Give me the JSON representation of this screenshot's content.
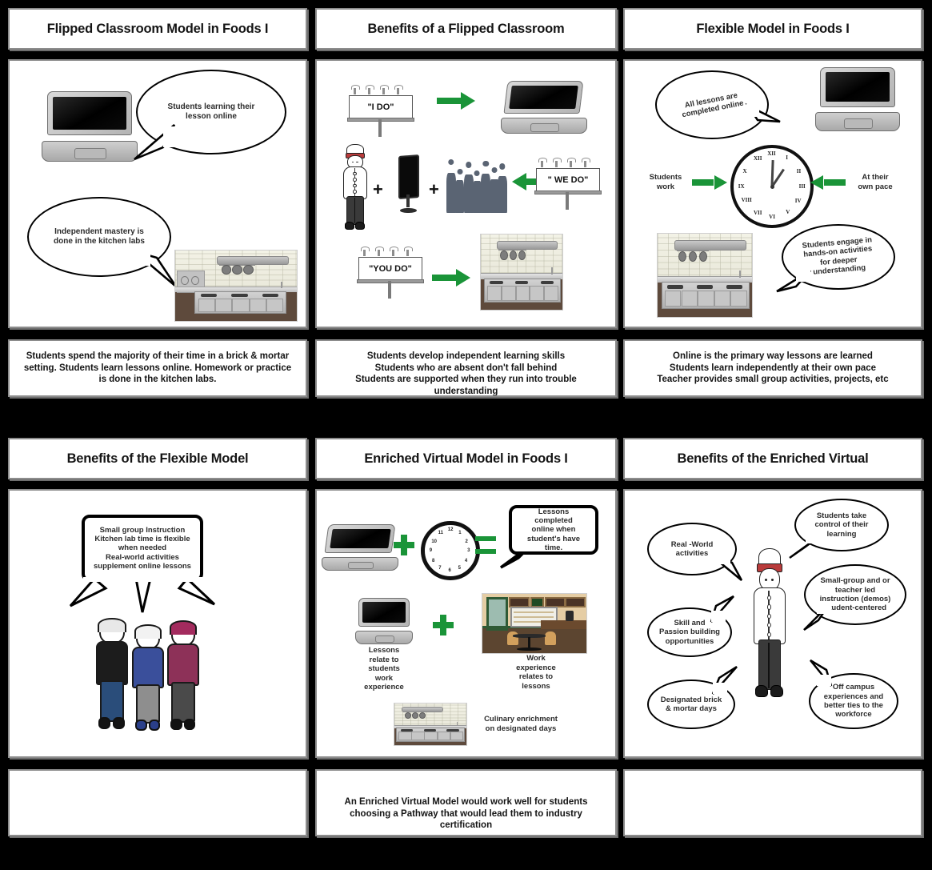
{
  "meta": {
    "kind": "storyboard",
    "rows": 2,
    "columns": 3,
    "background_color": "#000000",
    "panel_border_color": "#8c8c8c",
    "accent_green": "#1a9438",
    "text_color": "#141414"
  },
  "panels": [
    {
      "id": "panel-1",
      "title": "Flipped Classroom Model in Foods I",
      "bubbles": [
        {
          "text": "Students learning their\nlesson online"
        },
        {
          "text": "Independent mastery is\ndone in the kitchen labs"
        }
      ],
      "art_items": [
        "laptop-image",
        "kitchen-photo"
      ],
      "caption": "Students spend the majority of their time in a brick & mortar setting. Students learn lessons online. Homework or practice is done in the kitchen labs."
    },
    {
      "id": "panel-2",
      "title": "Benefits of a Flipped Classroom",
      "signs": [
        "\"I DO\"",
        "\" WE DO\"",
        "\"YOU DO\""
      ],
      "operators": [
        "+",
        "+"
      ],
      "art_items": [
        "billboard-sign",
        "laptop-image",
        "chef-character",
        "monitor-image",
        "student-crowd",
        "kitchen-photo"
      ],
      "caption": "Students develop independent learning skills\nStudents who are absent don't fall behind\nStudents are supported when they run into trouble understanding"
    },
    {
      "id": "panel-3",
      "title": "Flexible Model in Foods I",
      "bubbles": [
        {
          "text": "All lessons are\ncompleted online"
        },
        {
          "text": "Students engage in\nhands-on activities\nfor deeper\nunderstanding"
        }
      ],
      "labels": [
        "Students\nwork",
        "At their\nown pace"
      ],
      "clock": {
        "numerals": [
          "XII",
          "I",
          "II",
          "III",
          "IV",
          "V",
          "VI",
          "VII",
          "VIII",
          "IX",
          "X",
          "XII"
        ],
        "time": "12:00"
      },
      "art_items": [
        "laptop-image",
        "analog-clock",
        "kitchen-photo"
      ],
      "caption": "Online is the primary way lessons are learned\nStudents learn independently at their own pace\nTeacher provides small group activities, projects, etc"
    },
    {
      "id": "panel-4",
      "title": "Benefits of the Flexible Model",
      "bubbles": [
        {
          "text": "Small group Instruction\nKitchen lab time is flexible\nwhen needed\nReal-world activities\nsupplement online lessons"
        }
      ],
      "art_items": [
        "three-students"
      ],
      "caption": ""
    },
    {
      "id": "panel-5",
      "title": "Enriched Virtual Model in Foods I",
      "bubbles": [
        {
          "text": "Lessons completed\nonline when\nstudent's have time."
        }
      ],
      "labels": [
        "Lessons\nrelate to\nstudents\nwork\nexperience",
        "Work\nexperience\nrelates to\nlessons",
        "Culinary enrichment\non designated days"
      ],
      "operators": [
        "+",
        "=",
        "+"
      ],
      "art_items": [
        "laptop-image",
        "analog-clock",
        "cafe-photo",
        "kitchen-photo"
      ],
      "caption": "An Enriched Virtual Model would work well for students choosing a Pathway that would lead them to industry certification"
    },
    {
      "id": "panel-6",
      "title": "Benefits of the Enriched Virtual",
      "bubbles": [
        {
          "text": "Real -World\nactivities"
        },
        {
          "text": "Students take\ncontrol of their\nlearning"
        },
        {
          "text": "Skill and\nPassion building\nopportunities"
        },
        {
          "text": "Small-group and or\nteacher led\ninstruction (demos)\nStudent-centered"
        },
        {
          "text": "Designated brick\n& mortar days"
        },
        {
          "text": "Off campus\nexperiences and\nbetter ties to the\nworkforce"
        }
      ],
      "art_items": [
        "chef-character"
      ],
      "caption": ""
    }
  ]
}
